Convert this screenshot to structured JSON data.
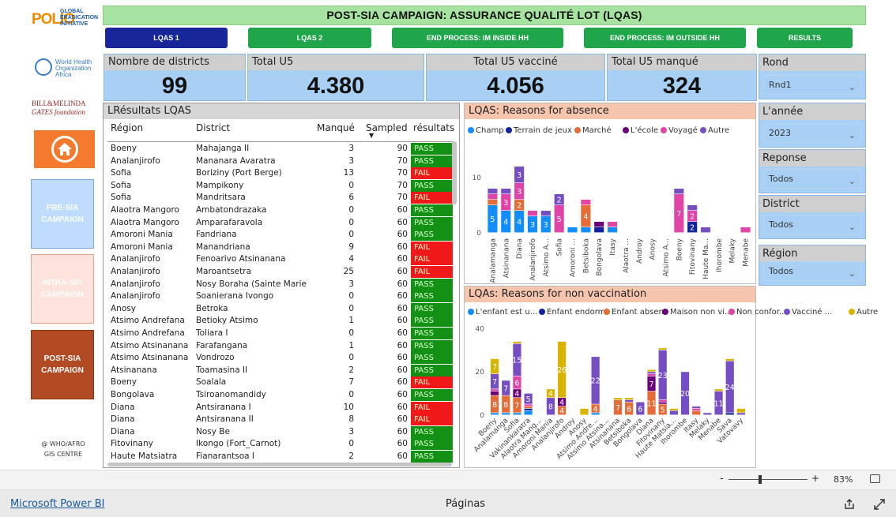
{
  "logos": {
    "polio_main": "POLIO",
    "polio_sub": [
      "GLOBAL",
      "ERADICATION",
      "INITIATIVE"
    ],
    "who_name": [
      "World Health",
      "Organization"
    ],
    "who_region": "Africa",
    "gates": [
      "BILL&MELINDA",
      "GATES foundation"
    ]
  },
  "side_nav": {
    "home_icon": "home-icon",
    "pre_sia": [
      "PRE-SIA",
      "CAMPAIGN"
    ],
    "intra_sia": [
      "INTRA-SIA",
      "CAMPAIGN"
    ],
    "post_sia": [
      "POST-SIA",
      "CAMPAIGN"
    ],
    "credit": [
      "@ WHO/AFRO",
      "GIS CENTRE"
    ]
  },
  "title": "POST-SIA CAMPAIGN: ASSURANCE QUALITÉ LOT (LQAS)",
  "tabs": [
    {
      "label": "LQAS 1",
      "active": true,
      "color": "#17279a"
    },
    {
      "label": "LQAS 2",
      "active": false,
      "color": "#1fa54a"
    },
    {
      "label": "END PROCESS: IM INSIDE HH",
      "active": false,
      "color": "#1fa54a"
    },
    {
      "label": "END PROCESS: IM OUTSIDE HH",
      "active": false,
      "color": "#1fa54a"
    },
    {
      "label": "RESULTS",
      "active": false,
      "color": "#1fa54a"
    }
  ],
  "kpis": [
    {
      "label": "Nombre de districts",
      "value": "99"
    },
    {
      "label": "Total U5",
      "value": "4.380"
    },
    {
      "label": "Total U5 vacciné",
      "value": "4.056"
    },
    {
      "label": "Total U5 manqué",
      "value": "324"
    }
  ],
  "filters": [
    {
      "label": "Rond",
      "value": "Rnd1"
    },
    {
      "label": "L'année",
      "value": "2023"
    },
    {
      "label": "Reponse",
      "value": "Todos"
    },
    {
      "label": "District",
      "value": "Todos"
    },
    {
      "label": "Région",
      "value": "Todos"
    }
  ],
  "table": {
    "title": "LRésultats LQAS",
    "columns": [
      "Région",
      "District",
      "Manqué",
      "Sampled",
      "résultats"
    ],
    "rows": [
      [
        "Boeny",
        "Mahajanga II",
        "3",
        "90",
        "PASS"
      ],
      [
        "Analanjirofo",
        "Mananara Avaratra",
        "3",
        "70",
        "PASS"
      ],
      [
        "Sofia",
        "Boriziny (Port Berge)",
        "13",
        "70",
        "FAIL"
      ],
      [
        "Sofia",
        "Mampikony",
        "0",
        "70",
        "PASS"
      ],
      [
        "Sofia",
        "Mandritsara",
        "6",
        "70",
        "FAIL"
      ],
      [
        "Alaotra Mangoro",
        "Ambatondrazaka",
        "0",
        "60",
        "PASS"
      ],
      [
        "Alaotra Mangoro",
        "Amparafaravola",
        "0",
        "60",
        "PASS"
      ],
      [
        "Amoroni Mania",
        "Fandriana",
        "0",
        "60",
        "PASS"
      ],
      [
        "Amoroni Mania",
        "Manandriana",
        "9",
        "60",
        "FAIL"
      ],
      [
        "Analanjirofo",
        "Fenoarivo Atsinanana",
        "4",
        "60",
        "FAIL"
      ],
      [
        "Analanjirofo",
        "Maroantsetra",
        "25",
        "60",
        "FAIL"
      ],
      [
        "Analanjirofo",
        "Nosy Boraha (Sainte Marie)",
        "3",
        "60",
        "PASS"
      ],
      [
        "Analanjirofo",
        "Soanierana Ivongo",
        "0",
        "60",
        "PASS"
      ],
      [
        "Anosy",
        "Betroka",
        "0",
        "60",
        "PASS"
      ],
      [
        "Atsimo Andrefana",
        "Betioky Atsimo",
        "1",
        "60",
        "PASS"
      ],
      [
        "Atsimo Andrefana",
        "Toliara I",
        "0",
        "60",
        "PASS"
      ],
      [
        "Atsimo Atsinanana",
        "Farafangana",
        "1",
        "60",
        "PASS"
      ],
      [
        "Atsimo Atsinanana",
        "Vondrozo",
        "0",
        "60",
        "PASS"
      ],
      [
        "Atsinanana",
        "Toamasina II",
        "2",
        "60",
        "PASS"
      ],
      [
        "Boeny",
        "Soalala",
        "7",
        "60",
        "FAIL"
      ],
      [
        "Bongolava",
        "Tsiroanomandidy",
        "0",
        "60",
        "PASS"
      ],
      [
        "Diana",
        "Antsiranana I",
        "10",
        "60",
        "FAIL"
      ],
      [
        "Diana",
        "Antsiranana II",
        "8",
        "60",
        "FAIL"
      ],
      [
        "Diana",
        "Nosy Be",
        "3",
        "60",
        "PASS"
      ],
      [
        "Fitovinany",
        "Ikongo (Fort_Carnot)",
        "0",
        "60",
        "PASS"
      ],
      [
        "Haute Matsiatra",
        "Fianarantsoa I",
        "2",
        "60",
        "PASS"
      ]
    ]
  },
  "chart_data": [
    {
      "type": "bar",
      "stacked": true,
      "title": "LQAS: Reasons for absence",
      "categories": [
        "Analamanga",
        "Atsinanana",
        "Diana",
        "Analanjirofo",
        "Atsimo A...",
        "Sofia",
        "Amoroni ...",
        "Betsiboka",
        "Bongolava",
        "Itasy",
        "Alaotra ...",
        "Androy",
        "Anosy",
        "Atsimo A...",
        "Boeny",
        "Fitovinany",
        "Haute Ma...",
        "Ihorombe",
        "Melaky",
        "Menabe"
      ],
      "series": [
        {
          "name": "Champ",
          "color": "#118dff",
          "values": [
            5,
            4,
            4,
            3,
            3,
            0,
            1,
            1,
            0,
            1,
            0,
            0,
            0,
            0,
            0,
            0,
            0,
            0,
            0,
            0
          ]
        },
        {
          "name": "Terrain de jeux",
          "color": "#12239e",
          "values": [
            0,
            0,
            0,
            0,
            0,
            0,
            0,
            0,
            1,
            0,
            0,
            0,
            0,
            0,
            0,
            2,
            0,
            0,
            0,
            0
          ]
        },
        {
          "name": "Marché",
          "color": "#e66c37",
          "values": [
            1,
            0,
            2,
            0,
            0,
            0,
            0,
            4,
            0,
            0,
            0,
            0,
            0,
            0,
            0,
            0,
            0,
            0,
            0,
            0
          ]
        },
        {
          "name": "L'école",
          "color": "#6b007b",
          "values": [
            0,
            0,
            0,
            0,
            0,
            0,
            0,
            0,
            1,
            0,
            0,
            0,
            0,
            0,
            0,
            0,
            0,
            0,
            0,
            0
          ]
        },
        {
          "name": "Voyagé",
          "color": "#e044a7",
          "values": [
            1,
            3,
            3,
            1,
            0,
            5,
            0,
            1,
            0,
            1,
            0,
            0,
            0,
            0,
            7,
            2,
            0,
            0,
            0,
            1
          ]
        },
        {
          "name": "Autre",
          "color": "#744ec2",
          "values": [
            1,
            1,
            3,
            0,
            1,
            2,
            0,
            0,
            0,
            0,
            0,
            0,
            0,
            0,
            1,
            1,
            1,
            0,
            0,
            0
          ]
        }
      ],
      "y_ticks": [
        "0",
        "10"
      ],
      "ylim": [
        0,
        12
      ]
    },
    {
      "type": "bar",
      "stacked": true,
      "title": "LQAs: Reasons for non vaccination",
      "categories": [
        "Boeny",
        "Analamanga",
        "Sofia",
        "Vakinankaratra",
        "Alaotra Mang...",
        "Amoroni Mania",
        "Analanjirofo",
        "Androy",
        "Anosy",
        "Atsimo Andre...",
        "Atsimo Atsina...",
        "Atsinanana",
        "Betsiboka",
        "Bongolava",
        "Diana",
        "Fitovinany",
        "Haute Matsia...",
        "Ihorombe",
        "Itasy",
        "Melaky",
        "Menabe",
        "Sava",
        "Vatovavy"
      ],
      "series": [
        {
          "name": "L'enfant est u...",
          "color": "#118dff",
          "values": [
            1,
            1,
            1,
            2,
            0,
            0,
            0,
            0,
            0,
            1,
            0,
            0,
            0,
            0,
            0,
            0,
            0,
            0,
            0,
            0,
            0,
            0,
            0
          ]
        },
        {
          "name": "Enfant endormi",
          "color": "#12239e",
          "values": [
            0,
            0,
            0,
            1,
            0,
            0,
            0,
            0,
            0,
            0,
            0,
            0,
            0,
            0,
            0,
            0,
            0,
            0,
            0,
            0,
            0,
            1,
            0
          ]
        },
        {
          "name": "Enfant absent",
          "color": "#e66c37",
          "values": [
            8,
            8,
            7,
            1,
            0,
            0,
            4,
            0,
            0,
            4,
            0,
            7,
            6,
            0,
            11,
            5,
            0,
            0,
            2,
            0,
            0,
            0,
            0
          ]
        },
        {
          "name": "Maison non vi...",
          "color": "#6b007b",
          "values": [
            2,
            0,
            4,
            0,
            0,
            0,
            4,
            0,
            0,
            0,
            0,
            0,
            0,
            0,
            7,
            1,
            0,
            0,
            0,
            0,
            0,
            0,
            0
          ]
        },
        {
          "name": "Non confor...",
          "color": "#e044a7",
          "values": [
            1,
            0,
            6,
            1,
            0,
            0,
            0,
            0,
            0,
            0,
            0,
            0,
            0,
            0,
            1,
            1,
            0,
            0,
            1,
            0,
            0,
            0,
            0
          ]
        },
        {
          "name": "Vacciné ...",
          "color": "#744ec2",
          "values": [
            7,
            7,
            15,
            5,
            0,
            8,
            0,
            0,
            0,
            22,
            0,
            0,
            1,
            6,
            1,
            23,
            2,
            20,
            1,
            1,
            11,
            24,
            1
          ]
        },
        {
          "name": "Autre",
          "color": "#d9b300",
          "values": [
            7,
            0,
            1,
            0,
            0,
            4,
            26,
            0,
            3,
            0,
            0,
            1,
            1,
            0,
            1,
            1,
            1,
            0,
            0,
            0,
            1,
            1,
            2
          ]
        }
      ],
      "y_ticks": [
        "0",
        "20",
        "40"
      ],
      "ylim": [
        0,
        42
      ]
    }
  ],
  "statusbar": {
    "zoom_minus": "-",
    "zoom_plus": "+",
    "zoom": "83%"
  },
  "footer": {
    "brand": "Microsoft Power BI",
    "pages": "Páginas"
  }
}
